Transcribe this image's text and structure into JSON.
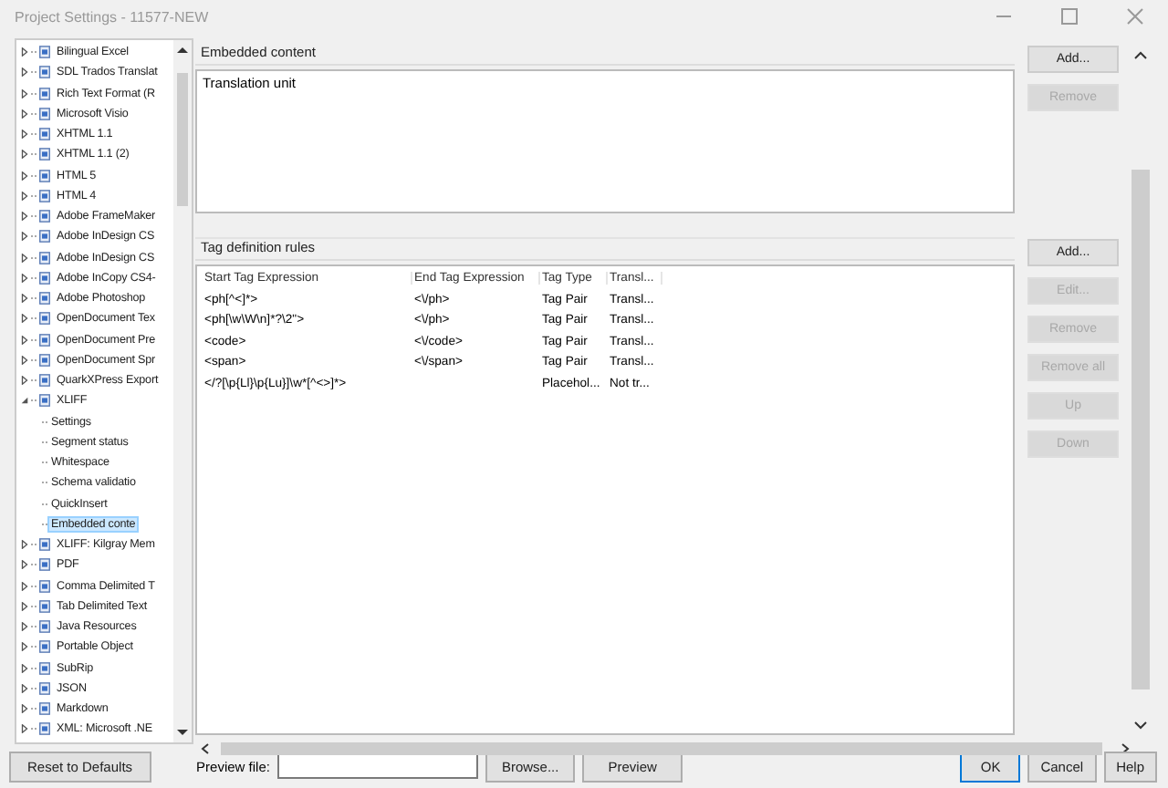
{
  "window": {
    "title": "Project Settings - 11577-NEW"
  },
  "tree": [
    {
      "label": "Bilingual Excel",
      "expanded": false,
      "selected": false
    },
    {
      "label": "SDL Trados Translat",
      "expanded": false,
      "selected": false
    },
    {
      "label": "Rich Text Format (R",
      "expanded": false,
      "selected": false
    },
    {
      "label": "Microsoft Visio",
      "expanded": false,
      "selected": false
    },
    {
      "label": "XHTML 1.1",
      "expanded": false,
      "selected": false
    },
    {
      "label": "XHTML 1.1 (2)",
      "expanded": false,
      "selected": false
    },
    {
      "label": "HTML 5",
      "expanded": false,
      "selected": false
    },
    {
      "label": "HTML 4",
      "expanded": false,
      "selected": false
    },
    {
      "label": "Adobe FrameMaker",
      "expanded": false,
      "selected": false
    },
    {
      "label": "Adobe InDesign CS",
      "expanded": false,
      "selected": false
    },
    {
      "label": "Adobe InDesign CS",
      "expanded": false,
      "selected": false
    },
    {
      "label": "Adobe InCopy CS4-",
      "expanded": false,
      "selected": false
    },
    {
      "label": "Adobe Photoshop",
      "expanded": false,
      "selected": false
    },
    {
      "label": "OpenDocument Tex",
      "expanded": false,
      "selected": false
    },
    {
      "label": "OpenDocument Pre",
      "expanded": false,
      "selected": false
    },
    {
      "label": "OpenDocument Spr",
      "expanded": false,
      "selected": false
    },
    {
      "label": "QuarkXPress Export",
      "expanded": false,
      "selected": false
    },
    {
      "label": "XLIFF",
      "expanded": true,
      "selected": false,
      "children": [
        {
          "label": "Settings",
          "selected": false
        },
        {
          "label": "Segment status",
          "selected": false
        },
        {
          "label": "Whitespace",
          "selected": false
        },
        {
          "label": "Schema validatio",
          "selected": false
        },
        {
          "label": "QuickInsert",
          "selected": false
        },
        {
          "label": "Embedded conte",
          "selected": true
        }
      ]
    },
    {
      "label": "XLIFF: Kilgray Mem",
      "expanded": false,
      "selected": false
    },
    {
      "label": "PDF",
      "expanded": false,
      "selected": false
    },
    {
      "label": "Comma Delimited T",
      "expanded": false,
      "selected": false
    },
    {
      "label": "Tab Delimited Text",
      "expanded": false,
      "selected": false
    },
    {
      "label": "Java Resources",
      "expanded": false,
      "selected": false
    },
    {
      "label": "Portable Object",
      "expanded": false,
      "selected": false
    },
    {
      "label": "SubRip",
      "expanded": false,
      "selected": false
    },
    {
      "label": "JSON",
      "expanded": false,
      "selected": false
    },
    {
      "label": "Markdown",
      "expanded": false,
      "selected": false
    },
    {
      "label": "XML: Microsoft .NE",
      "expanded": false,
      "selected": false
    }
  ],
  "embedded_content": {
    "heading": "Embedded content",
    "items": [
      "Translation unit"
    ],
    "buttons": [
      {
        "label": "Add...",
        "disabled": false
      },
      {
        "label": "Remove",
        "disabled": true
      }
    ]
  },
  "tag_rules": {
    "heading": "Tag definition rules",
    "columns": [
      "Start Tag Expression",
      "End Tag Expression",
      "Tag Type",
      "Transl..."
    ],
    "rows": [
      [
        "<ph[^<]*>",
        "<\\/ph>",
        "Tag Pair",
        "Transl..."
      ],
      [
        "<ph[\\w\\W\\n]*?\\2\">",
        "<\\/ph>",
        "Tag Pair",
        "Transl..."
      ],
      [
        "<code>",
        "<\\/code>",
        "Tag Pair",
        "Transl..."
      ],
      [
        "<span>",
        "<\\/span>",
        "Tag Pair",
        "Transl..."
      ],
      [
        "</?[\\p{Ll}\\p{Lu}]\\w*[^<>]*>",
        "",
        "Placehol...",
        "Not tr..."
      ]
    ],
    "buttons": [
      {
        "label": "Add...",
        "disabled": false
      },
      {
        "label": "Edit...",
        "disabled": true
      },
      {
        "label": "Remove",
        "disabled": true
      },
      {
        "label": "Remove all",
        "disabled": true
      },
      {
        "label": "Up",
        "disabled": true
      },
      {
        "label": "Down",
        "disabled": true
      }
    ]
  },
  "footer": {
    "reset_button": "Reset to Defaults",
    "preview_label": "Preview file:",
    "browse_button": "Browse...",
    "preview_button": "Preview",
    "buttons": [
      {
        "label": "OK",
        "default": true
      },
      {
        "label": "Cancel",
        "default": false
      },
      {
        "label": "Help",
        "default": false
      }
    ]
  }
}
